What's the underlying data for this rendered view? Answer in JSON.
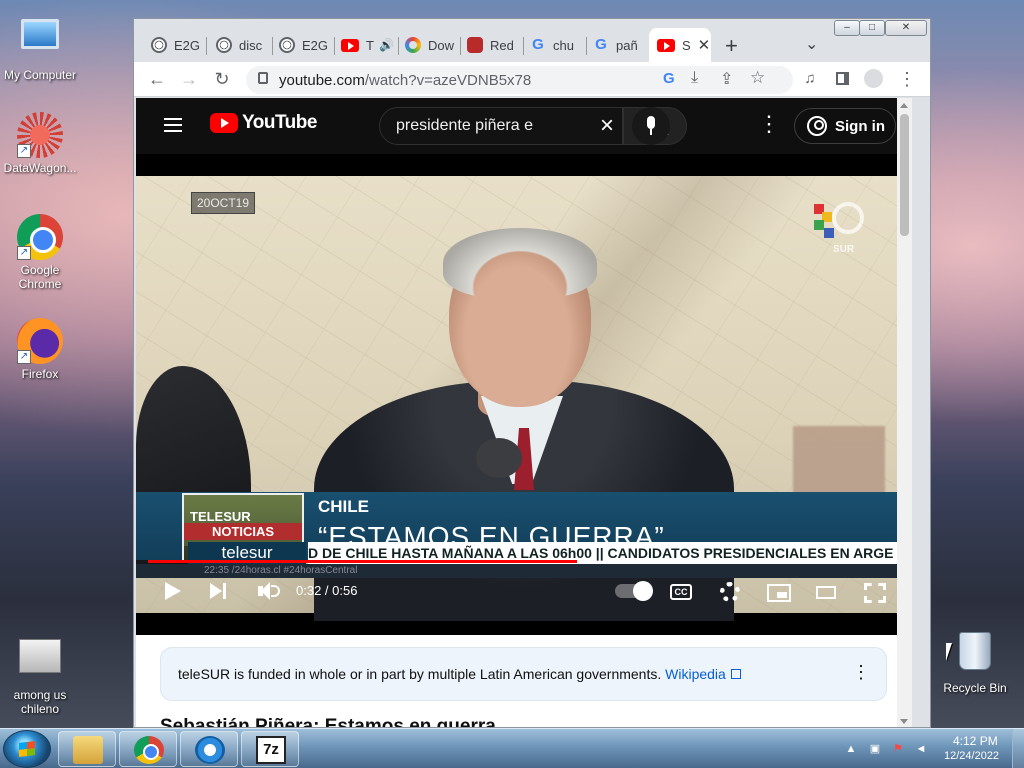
{
  "desktop": {
    "icons": [
      {
        "label": "My Computer"
      },
      {
        "label": "DataWagon..."
      },
      {
        "label": "Google Chrome"
      },
      {
        "label": "Firefox"
      },
      {
        "label": "among us chileno"
      },
      {
        "label": "Recycle Bin"
      }
    ]
  },
  "browser": {
    "tabs": [
      {
        "label": "E2G",
        "icon": "globe-icon"
      },
      {
        "label": "disc",
        "icon": "globe-icon"
      },
      {
        "label": "E2G",
        "icon": "globe-icon"
      },
      {
        "label": "T",
        "icon": "youtube-icon",
        "audio": true
      },
      {
        "label": "Dow",
        "icon": "colorful-ring-icon"
      },
      {
        "label": "Red",
        "icon": "red-app-icon"
      },
      {
        "label": "chu",
        "icon": "google-icon"
      },
      {
        "label": "pañ",
        "icon": "google-icon"
      },
      {
        "label": "S",
        "icon": "youtube-icon",
        "active": true
      }
    ],
    "new_tab_symbol": "+",
    "window_controls": {
      "minimize": "–",
      "restore": "□",
      "close": "✕"
    },
    "url_domain": "youtube.com",
    "url_path": "/watch?v=azeVDNB5x78"
  },
  "youtube": {
    "logo_text": "YouTube",
    "search_value": "presidente piñera e",
    "signin_label": "Sign in",
    "player": {
      "date_stamp": "20OCT19",
      "channel_mark": "SUR",
      "lower_third_country": "CHILE",
      "lower_third_headline": "“ESTAMOS EN GUERRA”",
      "brand_top": "TELESUR",
      "brand_bottom": "NOTICIAS",
      "brand_footer": "telesur",
      "ticker_text": "D DE CHILE HASTA MAÑANA A LAS 06h00  ||  CANDIDATOS PRESIDENCIALES EN ARGE",
      "ticker_small": "22:35    /24horas.cl     #24horasCentral",
      "current_time": "0:32",
      "duration": "0:56",
      "time_display": "0:32 / 0:56",
      "progress_fraction": 0.571
    },
    "notice_text": "teleSUR is funded in whole or in part by multiple Latin American governments.",
    "notice_link": "Wikipedia",
    "video_title": "Sebastián Piñera: Estamos en guerra"
  },
  "taskbar": {
    "clock_time": "4:12 PM",
    "clock_date": "12/24/2022"
  },
  "colors": {
    "youtube_red": "#ff0000",
    "youtube_header": "#0f0f0f",
    "telesur_blue": "#19506f",
    "link_blue": "#065fd4"
  }
}
